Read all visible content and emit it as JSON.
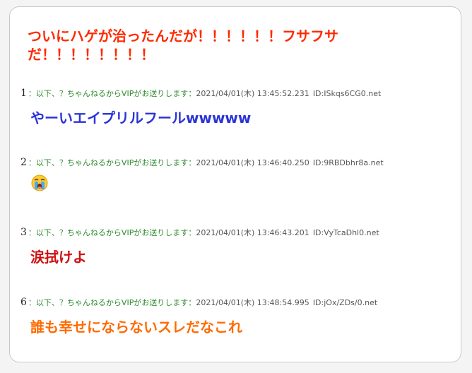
{
  "thread": {
    "title": "ついにハゲが治ったんだが！！！！！！フサフサだ！！！！！！！！"
  },
  "posts": [
    {
      "num": "1",
      "name": "：以下、？ちゃんねるからVIPがお送りします：",
      "date": "2021/04/01(木) 13:45:52.231",
      "id": "ID:ISkqs6CG0.net",
      "body": "やーいエイプリルフールwwwww",
      "body_color": "#2b34d8"
    },
    {
      "num": "2",
      "name": "：以下、？ちゃんねるからVIPがお送りします：",
      "date": "2021/04/01(木) 13:46:40.250",
      "id": "ID:9RBDbhr8a.net",
      "body_icon": "crying-face-icon"
    },
    {
      "num": "3",
      "name": "：以下、？ちゃんねるからVIPがお送りします：",
      "date": "2021/04/01(木) 13:46:43.201",
      "id": "ID:VyTcaDhl0.net",
      "body": "涙拭けよ",
      "body_color": "#d01010"
    },
    {
      "num": "6",
      "name": "：以下、？ちゃんねるからVIPがお送りします：",
      "date": "2021/04/01(木) 13:48:54.995",
      "id": "ID:jOx/ZDs/0.net",
      "body": "誰も幸せにならないスレだなこれ",
      "body_color": "#ff6a00"
    }
  ]
}
